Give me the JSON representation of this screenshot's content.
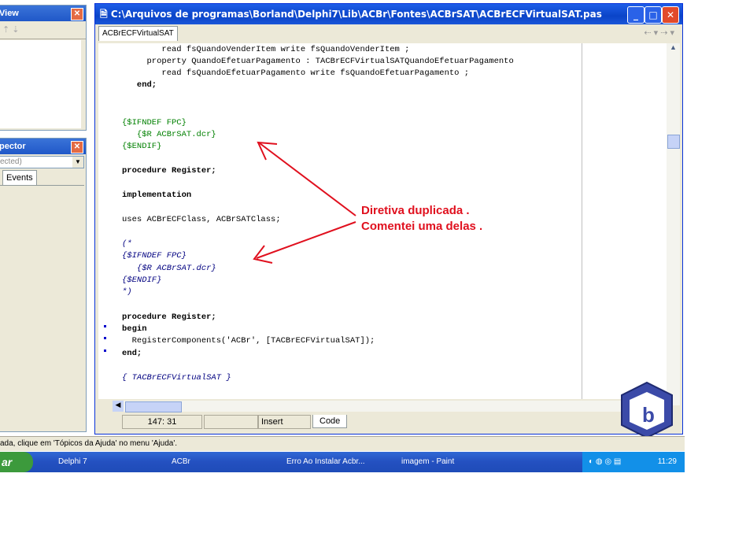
{
  "object_tree_panel": {
    "title": "View"
  },
  "inspector_panel": {
    "title": "pector",
    "dropdown_value": "ected)",
    "tab_events": "Events"
  },
  "window": {
    "title": "C:\\Arquivos de programas\\Borland\\Delphi7\\Lib\\ACBr\\Fontes\\ACBrSAT\\ACBrECFVirtualSAT.pas",
    "tab": "ACBrECFVirtualSAT"
  },
  "code_lines": [
    "        read fsQuandoVenderItem write fsQuandoVenderItem ;",
    "     property QuandoEfetuarPagamento : TACBrECFVirtualSATQuandoEfetuarPagamento",
    "        read fsQuandoEfetuarPagamento write fsQuandoEfetuarPagamento ;",
    "   end;",
    "{$IFNDEF FPC}",
    "   {$R ACBrSAT.dcr}",
    "{$ENDIF}",
    "procedure Register;",
    "implementation",
    "uses ACBrECFClass, ACBrSATClass;",
    "(*",
    "{$IFNDEF FPC}",
    "   {$R ACBrSAT.dcr}",
    "{$ENDIF}",
    "*)",
    "procedure Register;",
    "begin",
    "  RegisterComponents('ACBr', [TACBrECFVirtualSAT]);",
    "end;",
    "{ TACBrECFVirtualSAT }"
  ],
  "annotation": {
    "line1": "Diretiva duplicada .",
    "line2": "Comentei uma delas ."
  },
  "status": {
    "position": "147: 31",
    "mode": "Insert",
    "tab_code": "Code"
  },
  "help_bar": "ada, clique em 'Tópicos da Ajuda' no menu 'Ajuda'.",
  "taskbar": {
    "start": "ar",
    "items": [
      "Delphi 7",
      "ACBr",
      "Erro Ao Instalar Acbr...",
      "imagem - Paint"
    ],
    "clock": "11:29"
  },
  "colors": {
    "title_blue": "#0a44c8",
    "annotation_red": "#e0101e",
    "comment_green": "#008000"
  }
}
